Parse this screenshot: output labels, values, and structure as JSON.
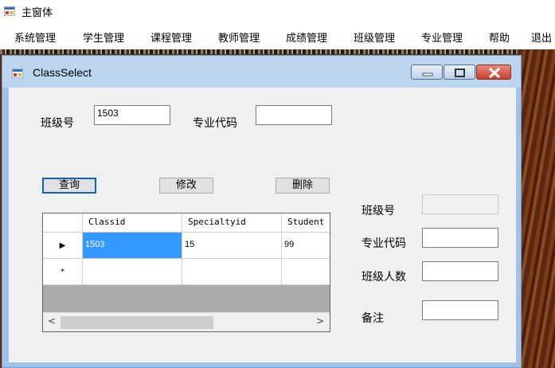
{
  "app": {
    "title": "主窗体",
    "icon": "form-app-icon"
  },
  "menu": [
    "系统管理",
    "学生管理",
    "课程管理",
    "教师管理",
    "成绩管理",
    "班级管理",
    "专业管理",
    "帮助",
    "退出"
  ],
  "child_window": {
    "title": "ClassSelect",
    "icon": "form-app-icon",
    "caption": {
      "minimize": "▭",
      "maximize": "□",
      "close": "✕"
    }
  },
  "search": {
    "class_no_label": "班级号",
    "class_no_value": "1503",
    "specialty_code_label": "专业代码",
    "specialty_code_value": ""
  },
  "buttons": {
    "query": "查询",
    "modify": "修改",
    "delete": "删除"
  },
  "grid": {
    "columns": [
      "Classid",
      "Specialtyid",
      "Student"
    ],
    "rows": [
      {
        "indicator": "▶",
        "cells": [
          "1503",
          "15",
          "99"
        ]
      },
      {
        "indicator": "*",
        "cells": [
          "",
          "",
          ""
        ]
      }
    ],
    "scroll_left": "<",
    "scroll_right": ">"
  },
  "details": {
    "class_no_label": "班级号",
    "specialty_code_label": "专业代码",
    "count_label": "班级人数",
    "remark_label": "备注",
    "class_no_value": "",
    "specialty_code_value": "",
    "count_value": "",
    "remark_value": ""
  },
  "colors": {
    "selection": "#3399ff",
    "window_frame": "#9ec3e6",
    "close_button": "#c5412c"
  }
}
